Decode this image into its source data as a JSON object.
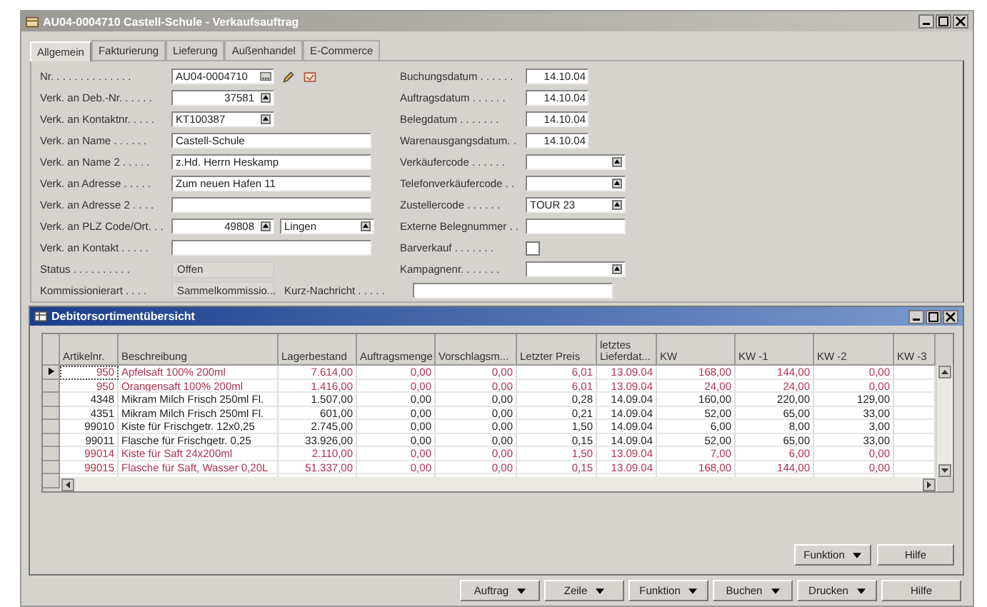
{
  "window": {
    "title": "AU04-0004710 Castell-Schule - Verkaufsauftrag"
  },
  "tabs": [
    {
      "label": "Allgemein",
      "selected": true
    },
    {
      "label": "Fakturierung",
      "selected": false
    },
    {
      "label": "Lieferung",
      "selected": false
    },
    {
      "label": "Außenhandel",
      "selected": false
    },
    {
      "label": "E-Commerce",
      "selected": false
    }
  ],
  "left_fields": [
    {
      "label": "Nr. . . . . . . . . . . . . .",
      "value": "AU04-0004710",
      "kind": "nr"
    },
    {
      "label": "Verk. an Deb.-Nr. . . . . .",
      "value": "37581",
      "kind": "num-lookup"
    },
    {
      "label": "Verk. an Kontaktnr. . . . .",
      "value": "KT100387",
      "kind": "lookup"
    },
    {
      "label": "Verk. an Name . . . . . .",
      "value": "Castell-Schule",
      "kind": "wide"
    },
    {
      "label": "Verk. an Name 2 . . . . .",
      "value": "z.Hd. Herrn Heskamp",
      "kind": "wide"
    },
    {
      "label": "Verk. an Adresse . . . . .",
      "value": "Zum neuen Hafen 11",
      "kind": "wide"
    },
    {
      "label": "Verk. an Adresse 2 . . . .",
      "kind": "wide"
    },
    {
      "label": "Verk. an PLZ Code/Ort. . .",
      "value": "49808",
      "value2": "Lingen",
      "kind": "plz"
    },
    {
      "label": "Verk. an Kontakt . . . . .",
      "kind": "wide"
    },
    {
      "label": "Status . . . . . . . . . .",
      "value": "Offen",
      "kind": "readonly"
    }
  ],
  "right_fields": [
    {
      "label": "Buchungsdatum . . . . . .",
      "value": "14.10.04",
      "kind": "date"
    },
    {
      "label": "Auftragsdatum . . . . . .",
      "value": "14.10.04",
      "kind": "date"
    },
    {
      "label": "Belegdatum . . . . . . .",
      "value": "14.10.04",
      "kind": "date"
    },
    {
      "label": "Warenausgangsdatum. .",
      "value": "14.10.04",
      "kind": "date"
    },
    {
      "label": "Verkäufercode . . . . . .",
      "kind": "lookup"
    },
    {
      "label": "Telefonverkäufercode . .",
      "kind": "lookup"
    },
    {
      "label": "Zustellercode . . . . . .",
      "value": "TOUR 23",
      "kind": "lookup"
    },
    {
      "label": "Externe Belegnummer . .",
      "kind": "text"
    },
    {
      "label": "Barverkauf . . . . . . .",
      "kind": "checkbox",
      "checked": false
    },
    {
      "label": "Kampagnenr. . . . . . .",
      "kind": "lookup"
    }
  ],
  "bottom_row": {
    "label": "Kommissionierart . . . .",
    "value": "Sammelkommissio...",
    "label2": "Kurz-Nachricht . . . . ."
  },
  "subwindow": {
    "title": "Debitorsortimentübersicht",
    "table": {
      "columns": [
        "Artikelnr.",
        "Beschreibung",
        "Lagerbestand",
        "Auftragsmenge",
        "Vorschlagsm...",
        "Letzter Preis",
        "letztes Lieferdat...",
        "KW",
        "KW -1",
        "KW -2",
        "KW -3"
      ],
      "rows": [
        {
          "cells": [
            "950",
            "Apfelsaft 100% 200ml",
            "7.614,00",
            "0,00",
            "0,00",
            "6,01",
            "13.09.04",
            "168,00",
            "144,00",
            "0,00"
          ],
          "color": "#b0304a",
          "selected": true
        },
        {
          "cells": [
            "950",
            "Orangensaft 100% 200ml",
            "1.416,00",
            "0,00",
            "0,00",
            "6,01",
            "13.09.04",
            "24,00",
            "24,00",
            "0,00"
          ],
          "color": "#b0304a",
          "selected": false
        },
        {
          "cells": [
            "4348",
            "Mikram Milch Frisch 250ml Fl.",
            "1.507,00",
            "0,00",
            "0,00",
            "0,28",
            "14.09.04",
            "160,00",
            "220,00",
            "129,00"
          ],
          "color": "#202020",
          "selected": false
        },
        {
          "cells": [
            "4351",
            "Mikram Milch Frisch 250ml Fl.",
            "601,00",
            "0,00",
            "0,00",
            "0,21",
            "14.09.04",
            "52,00",
            "65,00",
            "33,00"
          ],
          "color": "#202020",
          "selected": false
        },
        {
          "cells": [
            "99010",
            "Kiste für Frischgetr. 12x0,25",
            "2.745,00",
            "0,00",
            "0,00",
            "1,50",
            "14.09.04",
            "6,00",
            "8,00",
            "3,00"
          ],
          "color": "#202020",
          "selected": false
        },
        {
          "cells": [
            "99011",
            "Flasche für Frischgetr. 0,25",
            "33.926,00",
            "0,00",
            "0,00",
            "0,15",
            "14.09.04",
            "52,00",
            "65,00",
            "33,00"
          ],
          "color": "#202020",
          "selected": false
        },
        {
          "cells": [
            "99014",
            "Kiste für Saft 24x200ml",
            "2.110,00",
            "0,00",
            "0,00",
            "1,50",
            "13.09.04",
            "7,00",
            "6,00",
            "0,00"
          ],
          "color": "#b0304a",
          "selected": false
        },
        {
          "cells": [
            "99015",
            "Flasche für Saft, Wasser 0,20L",
            "51.337,00",
            "0,00",
            "0,00",
            "0,15",
            "13.09.04",
            "168,00",
            "144,00",
            "0,00"
          ],
          "color": "#b0304a",
          "selected": false
        }
      ]
    },
    "buttons": [
      {
        "label": "Funktion",
        "dropdown": true
      },
      {
        "label": "Hilfe",
        "dropdown": false
      }
    ]
  },
  "buttons": [
    {
      "label": "Auftrag",
      "dropdown": true
    },
    {
      "label": "Zeile",
      "dropdown": true
    },
    {
      "label": "Funktion",
      "dropdown": true
    },
    {
      "label": "Buchen",
      "dropdown": true
    },
    {
      "label": "Drucken",
      "dropdown": true
    },
    {
      "label": "Hilfe",
      "dropdown": false
    }
  ]
}
